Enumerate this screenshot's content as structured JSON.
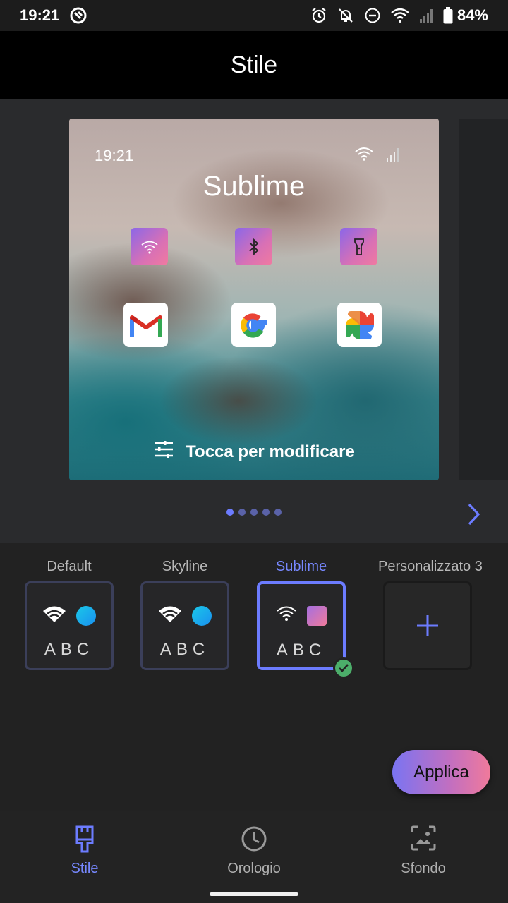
{
  "status_bar": {
    "time": "19:21",
    "battery": "84%",
    "icons": [
      "assistant-icon",
      "alarm-icon",
      "notifications-off-icon",
      "dnd-icon",
      "wifi-icon",
      "signal-icon",
      "battery-icon"
    ]
  },
  "header": {
    "title": "Stile"
  },
  "preview": {
    "time": "19:21",
    "style_name": "Sublime",
    "quick_tiles": [
      "wifi-icon",
      "bluetooth-icon",
      "flashlight-icon"
    ],
    "apps": [
      "gmail-icon",
      "google-icon",
      "google-photos-icon"
    ],
    "edit_label": "Tocca per modificare",
    "page_count": 5,
    "active_page": 1
  },
  "styles": {
    "items": [
      {
        "label": "Default",
        "preview_text": "ABC",
        "selected": false
      },
      {
        "label": "Skyline",
        "preview_text": "ABC",
        "selected": false
      },
      {
        "label": "Sublime",
        "preview_text": "ABC",
        "selected": true
      },
      {
        "label": "Personalizzato 3",
        "add": true
      }
    ],
    "apply_label": "Applica"
  },
  "bottom_nav": {
    "items": [
      {
        "label": "Stile",
        "icon": "brush-icon",
        "active": true
      },
      {
        "label": "Orologio",
        "icon": "clock-icon",
        "active": false
      },
      {
        "label": "Sfondo",
        "icon": "wallpaper-icon",
        "active": false
      }
    ]
  },
  "colors": {
    "accent": "#6c7cff",
    "gradient_start": "#7a74f2",
    "gradient_end": "#f07a9b"
  }
}
